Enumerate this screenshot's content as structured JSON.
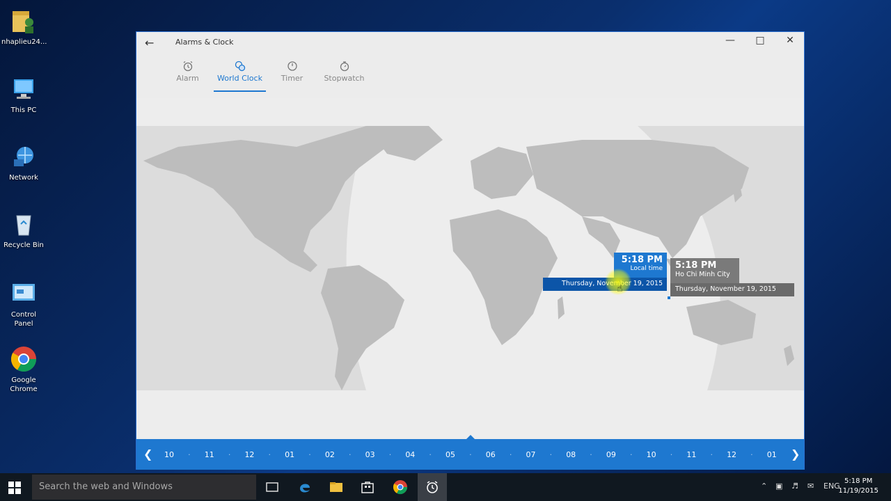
{
  "desktop": {
    "icons": [
      {
        "label": "nhaplieu24..."
      },
      {
        "label": "This PC"
      },
      {
        "label": "Network"
      },
      {
        "label": "Recycle Bin"
      },
      {
        "label": "Control Panel"
      },
      {
        "label": "Google Chrome"
      }
    ]
  },
  "window": {
    "title": "Alarms & Clock",
    "tabs": [
      {
        "label": "Alarm",
        "icon": "alarm-icon"
      },
      {
        "label": "World Clock",
        "icon": "world-clock-icon"
      },
      {
        "label": "Timer",
        "icon": "timer-icon"
      },
      {
        "label": "Stopwatch",
        "icon": "stopwatch-icon"
      }
    ],
    "active_tab": "World Clock",
    "accent": "#1e78d0"
  },
  "map": {
    "local": {
      "time": "5:18 PM",
      "label": "Local time",
      "date": "Thursday, November 19, 2015"
    },
    "city": {
      "time": "5:18 PM",
      "name": "Ho Chi Minh City",
      "date": "Thursday, November 19, 2015"
    }
  },
  "timeline": {
    "hours": [
      "10",
      "11",
      "12",
      "01",
      "02",
      "03",
      "04",
      "05",
      "06",
      "07",
      "08",
      "09",
      "10",
      "11",
      "12",
      "01"
    ]
  },
  "taskbar": {
    "search_placeholder": "Search the web and Windows",
    "language": "ENG",
    "time": "5:18 PM",
    "date": "11/19/2015"
  }
}
